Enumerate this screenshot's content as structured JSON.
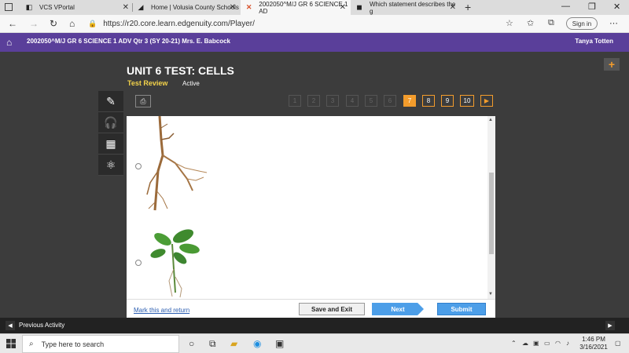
{
  "browser": {
    "tabs": [
      {
        "title": "VCS VPortal",
        "active": false
      },
      {
        "title": "Home | Volusia County Schools",
        "active": false
      },
      {
        "title": "2002050^M/J GR 6 SCIENCE 1 AD",
        "active": true
      },
      {
        "title": "Which statement describes the g",
        "active": false
      }
    ],
    "url": "https://r20.core.learn.edgenuity.com/Player/",
    "signin_label": "Sign in"
  },
  "course": {
    "title": "2002050^M/J GR 6 SCIENCE 1 ADV Qtr 3 (SY 20-21) Mrs. E. Babcock",
    "user_name": "Tanya Totten"
  },
  "test": {
    "title": "UNIT 6 TEST: CELLS",
    "section": "Test Review",
    "status": "Active"
  },
  "pager": {
    "pages": [
      "1",
      "2",
      "3",
      "4",
      "5",
      "6",
      "7",
      "8",
      "9",
      "10"
    ],
    "current": "7"
  },
  "footer": {
    "mark_link": "Mark this and return",
    "save_label": "Save and Exit",
    "next_label": "Next",
    "submit_label": "Submit"
  },
  "activity": {
    "prev_label": "Previous Activity"
  },
  "taskbar": {
    "search_placeholder": "Type here to search",
    "time": "1:46 PM",
    "date": "3/16/2021"
  },
  "colors": {
    "course_bar": "#5a3f9a",
    "accent_orange": "#f39c2c",
    "button_blue": "#4c9ee8",
    "test_review_yellow": "#f3d24a"
  }
}
